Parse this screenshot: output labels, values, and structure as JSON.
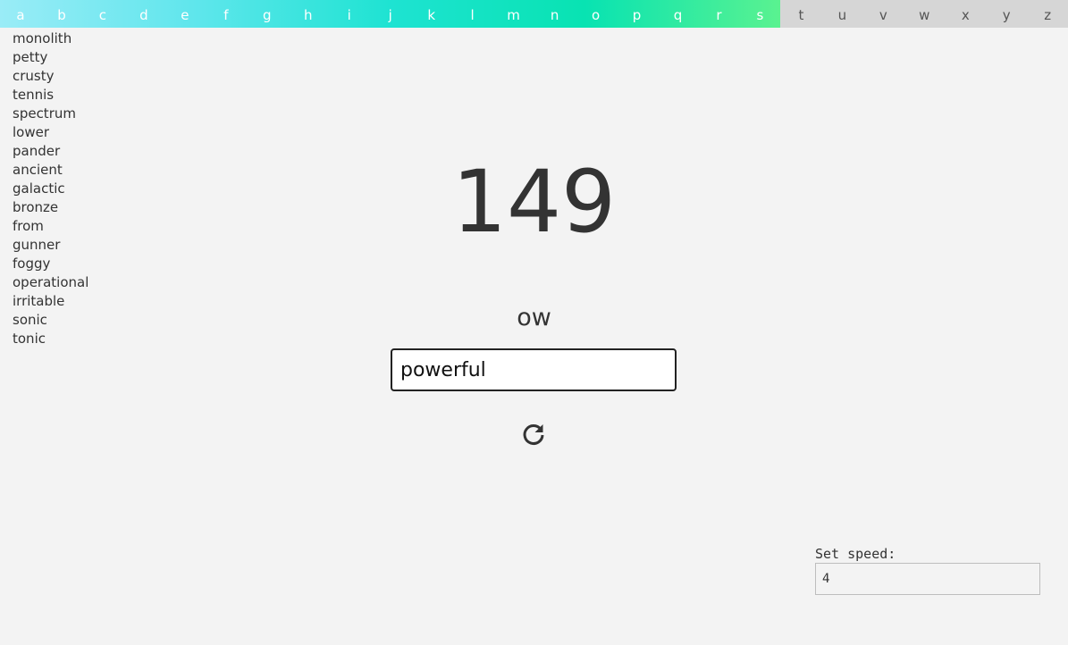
{
  "alphabet": {
    "letters": [
      "a",
      "b",
      "c",
      "d",
      "e",
      "f",
      "g",
      "h",
      "i",
      "j",
      "k",
      "l",
      "m",
      "n",
      "o",
      "p",
      "q",
      "r",
      "s",
      "t",
      "u",
      "v",
      "w",
      "x",
      "y",
      "z"
    ],
    "completed_count": 19,
    "colors": {
      "progress_gradient": [
        "#9aecf7",
        "#5fe6ec",
        "#1ee3d2",
        "#08e3b2",
        "#5af290"
      ],
      "remaining": "#d6d6d6"
    }
  },
  "word_list": [
    "monolith",
    "petty",
    "crusty",
    "tennis",
    "spectrum",
    "lower",
    "pander",
    "ancient",
    "galactic",
    "bronze",
    "from",
    "gunner",
    "foggy",
    "operational",
    "irritable",
    "sonic",
    "tonic"
  ],
  "score": "149",
  "prompt": "ow",
  "input": {
    "value": "powerful"
  },
  "restart_icon": "refresh-icon",
  "speed": {
    "label": "Set speed:",
    "value": "4"
  }
}
